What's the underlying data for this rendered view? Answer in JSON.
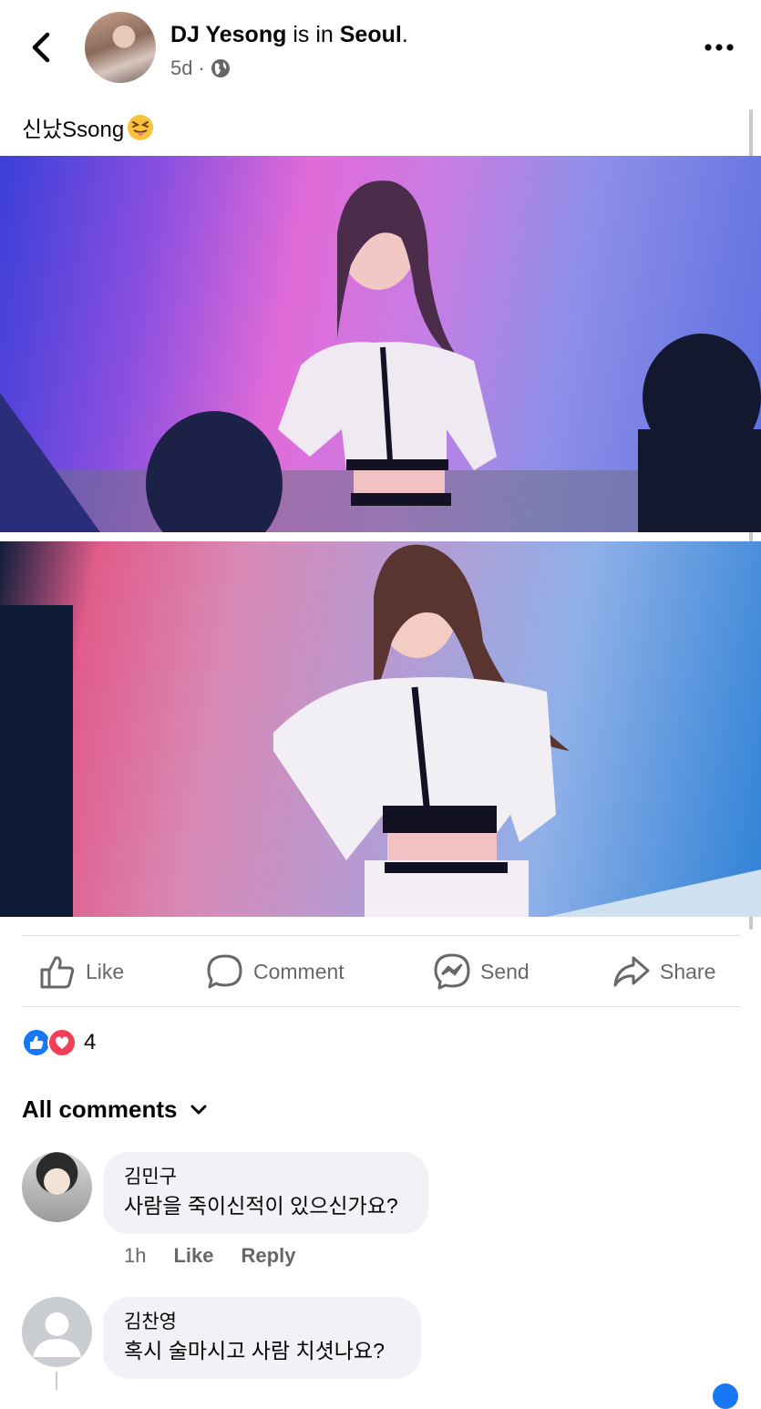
{
  "header": {
    "author": "DJ Yesong",
    "location_connector": "is in",
    "location": "Seoul",
    "period": ".",
    "time": "5d",
    "separator": "·",
    "audience_icon": "globe-icon"
  },
  "post": {
    "caption": "신났Ssong",
    "caption_emoji": "😝"
  },
  "actions": {
    "like": "Like",
    "comment": "Comment",
    "send": "Send",
    "share": "Share"
  },
  "reactions": {
    "count": "4",
    "types": [
      "like",
      "love"
    ]
  },
  "comments_header": {
    "label": "All comments"
  },
  "comments": [
    {
      "name": "김민구",
      "text": "사람을 죽이신적이 있으신가요?",
      "time": "1h",
      "like": "Like",
      "reply": "Reply"
    },
    {
      "name": "김찬영",
      "text": "혹시  술마시고 사람 치셧나요?"
    }
  ],
  "colors": {
    "accent": "#1877f2",
    "love": "#f33e58",
    "secondary_text": "#65676b",
    "bubble": "#f0f2f5"
  }
}
